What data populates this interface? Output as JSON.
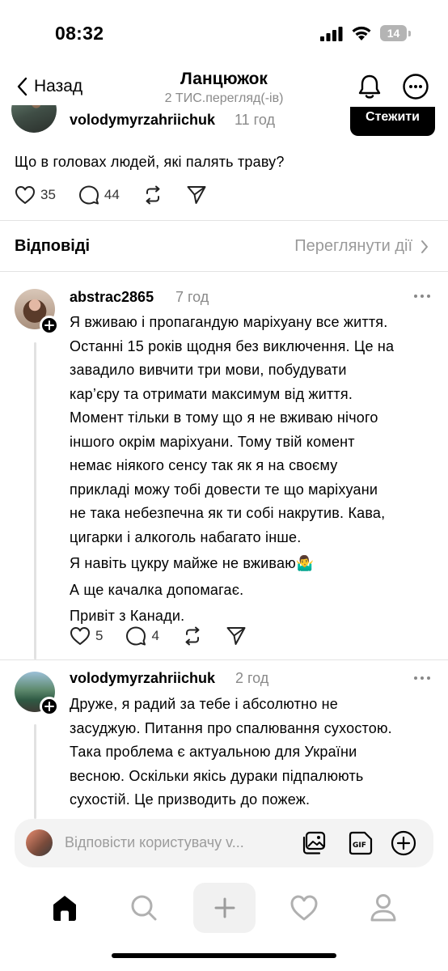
{
  "status_bar": {
    "time": "08:32",
    "battery": "14",
    "icons": [
      "cellular-signal-icon",
      "wifi-icon",
      "battery-icon"
    ]
  },
  "header": {
    "back_label": "Назад",
    "title": "Ланцюжок",
    "subtitle": "2 ТИС.перегляд(-ів)",
    "icons": [
      "chevron-left-icon",
      "bell-icon",
      "more-circle-icon"
    ]
  },
  "main_post": {
    "username": "volodymyrzahriichuk",
    "time": "11 год",
    "follow_label": "Стежити",
    "text": "Що в головах людей, які палять траву?",
    "likes": "35",
    "comments": "44"
  },
  "replies_bar": {
    "label": "Відповіді",
    "view_activity": "Переглянути дії"
  },
  "replies": [
    {
      "username": "abstrac2865",
      "time": "7 год",
      "lines": [
        "Я вживаю і пропагандую маріхуану все життя.",
        "Останні 15 років щодня без виключення. Це на",
        "завадило вивчити три мови, побудувати",
        "кар’єру та отримати максимум від життя.",
        "Момент тільки в тому що я не вживаю нічого",
        "іншого окрім маріхуани. Тому твій комент",
        "немає ніякого сенсу так як я на своєму",
        "прикладі можу тобі довести те що маріхуани",
        "не така небезпечна як ти собі накрутив. Кава,",
        "цигарки і алкоголь набагато інше.",
        "Я навіть цукру майже не вживаю🤷‍♂️",
        "А ще качалка допомагає.",
        "Привіт з Канади."
      ],
      "likes": "5",
      "comments": "4"
    },
    {
      "username": "volodymyrzahriichuk",
      "time": "2 год",
      "lines": [
        "Друже, я радий за тебе і абсолютно не",
        "засуджую. Питання про спалювання сухостою.",
        "Така проблема є актуальною для України",
        "весною. Оскільки якісь дураки підпалюють",
        "сухостій. Це призводить до пожеж."
      ]
    }
  ],
  "composer": {
    "placeholder": "Відповісти користувачу v..."
  },
  "tabbar": {
    "items": [
      "home-icon",
      "search-icon",
      "create-plus-icon",
      "activity-heart-icon",
      "profile-icon"
    ]
  }
}
